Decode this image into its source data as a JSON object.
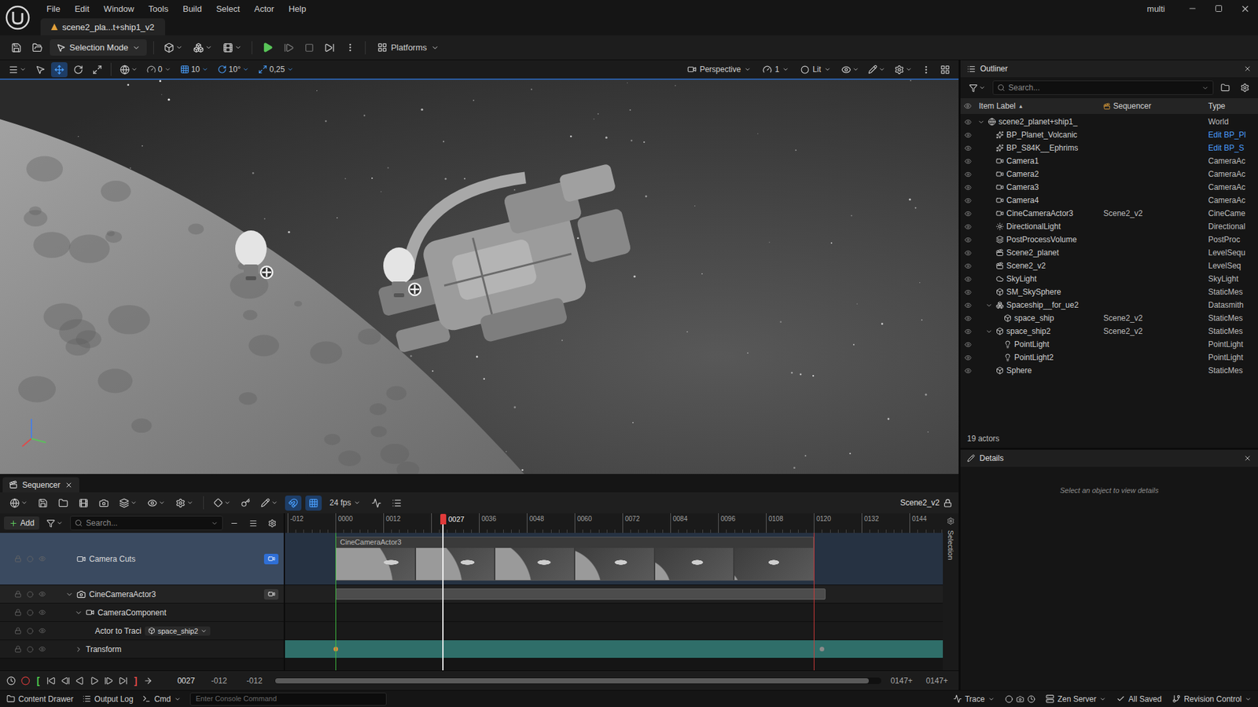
{
  "menu_bar": {
    "items": [
      "File",
      "Edit",
      "Window",
      "Tools",
      "Build",
      "Select",
      "Actor",
      "Help"
    ],
    "user": "multi"
  },
  "document_tab": {
    "label": "scene2_pla...t+ship1_v2",
    "selected": true
  },
  "main_toolbar": {
    "mode": "Selection Mode",
    "platforms": "Platforms"
  },
  "viewport_toolbar": {
    "tools": [
      {
        "kind": "select",
        "selected": false
      },
      {
        "kind": "move",
        "selected": true
      },
      {
        "kind": "rotate",
        "selected": false
      },
      {
        "kind": "scale",
        "selected": false
      }
    ],
    "snaps": [
      {
        "value": "0",
        "active": false
      },
      {
        "value": "10",
        "active": true
      },
      {
        "value": "10°",
        "active": true
      },
      {
        "value": "0,25",
        "active": true
      }
    ],
    "view": "Perspective",
    "camera_speed": "1",
    "view_mode": "Lit"
  },
  "outliner": {
    "title": "Outliner",
    "search_placeholder": "Search...",
    "columns": [
      "Item Label",
      "Sequencer",
      "Type"
    ],
    "sort_indicator": "▲",
    "rows": [
      {
        "label": "scene2_planet+ship1_",
        "sequencer": "",
        "type": "World",
        "depth": 0,
        "has_children": true,
        "expanded": true,
        "link": false
      },
      {
        "label": "BP_Planet_Volcanic",
        "sequencer": "",
        "type": "Edit BP_Pl",
        "depth": 1,
        "has_children": false,
        "expanded": false,
        "link": true
      },
      {
        "label": "BP_S84K__Ephrims",
        "sequencer": "",
        "type": "Edit BP_S",
        "depth": 1,
        "has_children": false,
        "expanded": false,
        "link": true
      },
      {
        "label": "Camera1",
        "sequencer": "",
        "type": "CameraAc",
        "depth": 1,
        "has_children": false,
        "expanded": false,
        "link": false
      },
      {
        "label": "Camera2",
        "sequencer": "",
        "type": "CameraAc",
        "depth": 1,
        "has_children": false,
        "expanded": false,
        "link": false
      },
      {
        "label": "Camera3",
        "sequencer": "",
        "type": "CameraAc",
        "depth": 1,
        "has_children": false,
        "expanded": false,
        "link": false
      },
      {
        "label": "Camera4",
        "sequencer": "",
        "type": "CameraAc",
        "depth": 1,
        "has_children": false,
        "expanded": false,
        "link": false
      },
      {
        "label": "CineCameraActor3",
        "sequencer": "Scene2_v2",
        "type": "CineCame",
        "depth": 1,
        "has_children": false,
        "expanded": false,
        "link": false
      },
      {
        "label": "DirectionalLight",
        "sequencer": "",
        "type": "Directional",
        "depth": 1,
        "has_children": false,
        "expanded": false,
        "link": false
      },
      {
        "label": "PostProcessVolume",
        "sequencer": "",
        "type": "PostProc",
        "depth": 1,
        "has_children": false,
        "expanded": false,
        "link": false
      },
      {
        "label": "Scene2_planet",
        "sequencer": "",
        "type": "LevelSequ",
        "depth": 1,
        "has_children": false,
        "expanded": false,
        "link": false
      },
      {
        "label": "Scene2_v2",
        "sequencer": "",
        "type": "LevelSeq",
        "depth": 1,
        "has_children": false,
        "expanded": false,
        "link": false
      },
      {
        "label": "SkyLight",
        "sequencer": "",
        "type": "SkyLight",
        "depth": 1,
        "has_children": false,
        "expanded": false,
        "link": false
      },
      {
        "label": "SM_SkySphere",
        "sequencer": "",
        "type": "StaticMes",
        "depth": 1,
        "has_children": false,
        "expanded": false,
        "link": false
      },
      {
        "label": "Spaceship__for_ue2",
        "sequencer": "",
        "type": "Datasmith",
        "depth": 1,
        "has_children": true,
        "expanded": true,
        "link": false
      },
      {
        "label": "space_ship",
        "sequencer": "Scene2_v2",
        "type": "StaticMes",
        "depth": 2,
        "has_children": false,
        "expanded": false,
        "link": false
      },
      {
        "label": "space_ship2",
        "sequencer": "Scene2_v2",
        "type": "StaticMes",
        "depth": 1,
        "has_children": true,
        "expanded": true,
        "link": false
      },
      {
        "label": "PointLight",
        "sequencer": "",
        "type": "PointLight",
        "depth": 2,
        "has_children": false,
        "expanded": false,
        "link": false
      },
      {
        "label": "PointLight2",
        "sequencer": "",
        "type": "PointLight",
        "depth": 2,
        "has_children": false,
        "expanded": false,
        "link": false
      },
      {
        "label": "Sphere",
        "sequencer": "",
        "type": "StaticMes",
        "depth": 1,
        "has_children": false,
        "expanded": false,
        "link": false
      }
    ],
    "footer": "19 actors"
  },
  "details": {
    "title": "Details",
    "empty_message": "Select an object to view details"
  },
  "sequencer": {
    "title": "Sequencer",
    "frame_rate": "24 fps",
    "sequence": "Scene2_v2",
    "toggles": [
      {
        "kind": "snap",
        "on": true
      },
      {
        "kind": "frame-snap",
        "on": true
      }
    ],
    "add_label": "Add",
    "search_placeholder": "Search...",
    "selection_label": "Selection",
    "playhead": "0027",
    "ticks": [
      "-012",
      "0000",
      "0012",
      "",
      "0036",
      "0048",
      "0060",
      "0072",
      "0084",
      "0096",
      "0108",
      "0120",
      "0132",
      "0144"
    ],
    "section_label": "CineCameraActor3",
    "tracks": [
      {
        "kind": "camera-cuts",
        "label": "Camera Cuts",
        "has_children": false,
        "expanded": false,
        "button": "on",
        "value": ""
      },
      {
        "kind": "actor",
        "label": "CineCameraActor3",
        "has_children": true,
        "expanded": true,
        "button": "off",
        "value": ""
      },
      {
        "kind": "component",
        "label": "CameraComponent",
        "has_children": true,
        "expanded": true,
        "button": "none",
        "value": ""
      },
      {
        "kind": "property",
        "label": "Actor to Traci",
        "has_children": false,
        "expanded": false,
        "button": "none",
        "value": "space_ship2"
      },
      {
        "kind": "transform",
        "label": "Transform",
        "has_children": true,
        "expanded": false,
        "button": "none",
        "value": ""
      }
    ],
    "transport": {
      "mark_in": "[",
      "mark_out": "]",
      "frame": "0027",
      "start": "-012",
      "view_start": "-012",
      "view_end": "0147+",
      "end": "0147+",
      "scroll_level": 0.98
    }
  },
  "status_bar": {
    "content_drawer": "Content Drawer",
    "output_log": "Output Log",
    "cmd": "Cmd",
    "console_placeholder": "Enter Console Command",
    "trace": "Trace",
    "zen_server": "Zen Server",
    "save_state": "All Saved",
    "revision_control": "Revision Control"
  }
}
